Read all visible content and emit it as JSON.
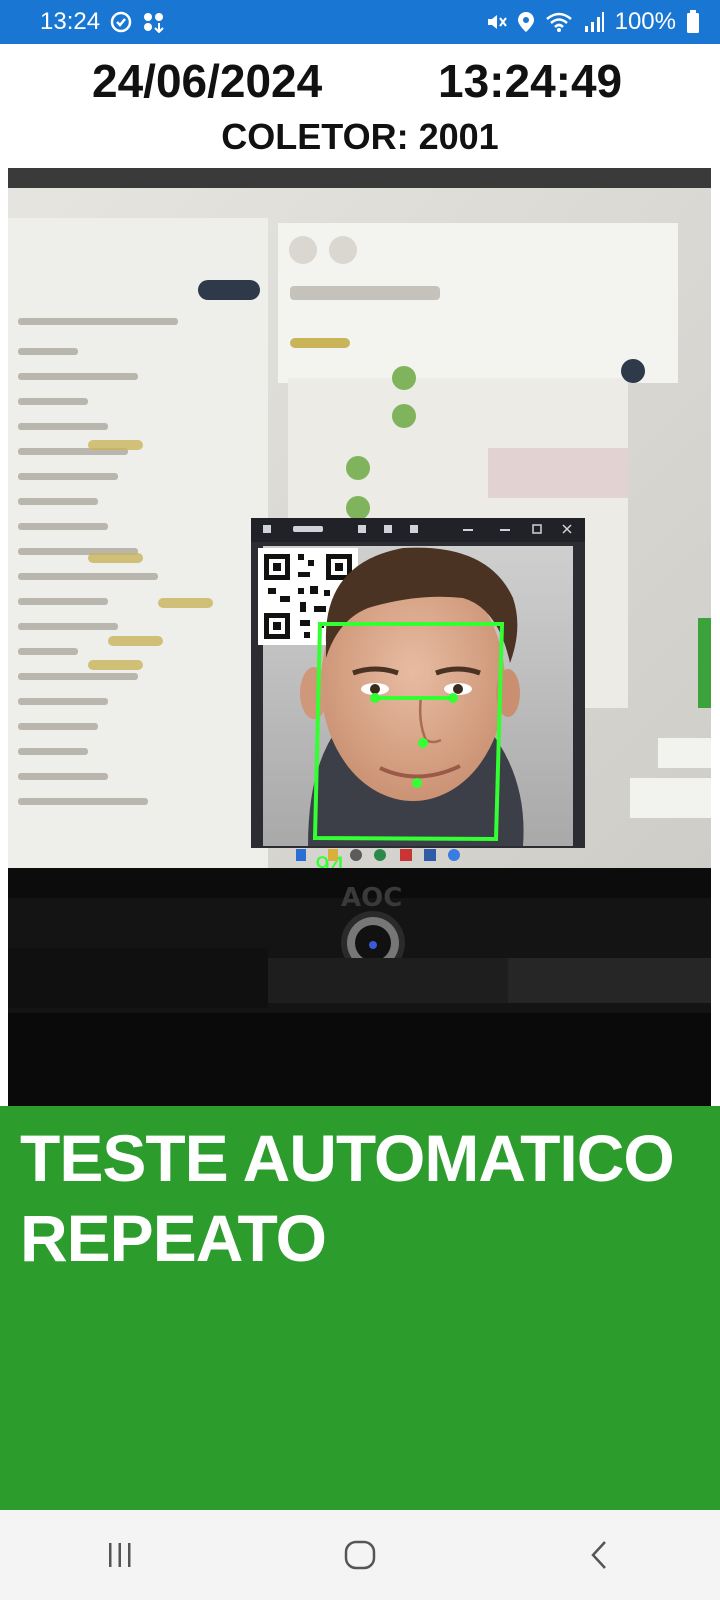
{
  "status_bar": {
    "time": "13:24",
    "battery": "100%",
    "icons": [
      "sync-icon",
      "notification-dots-icon",
      "mute-icon",
      "location-icon",
      "wifi-icon",
      "signal-icon",
      "battery-icon"
    ]
  },
  "header": {
    "date": "24/06/2024",
    "time": "13:24:49",
    "collector": "COLETOR: 2001"
  },
  "camera": {
    "confidence": "94",
    "overlay_color": "#33ff33"
  },
  "result": {
    "message": "TESTE AUTOMATICO REPEATO",
    "background_color": "#2c9c2c"
  },
  "nav": {
    "icons": [
      "recent-apps-icon",
      "home-icon",
      "back-icon"
    ]
  }
}
